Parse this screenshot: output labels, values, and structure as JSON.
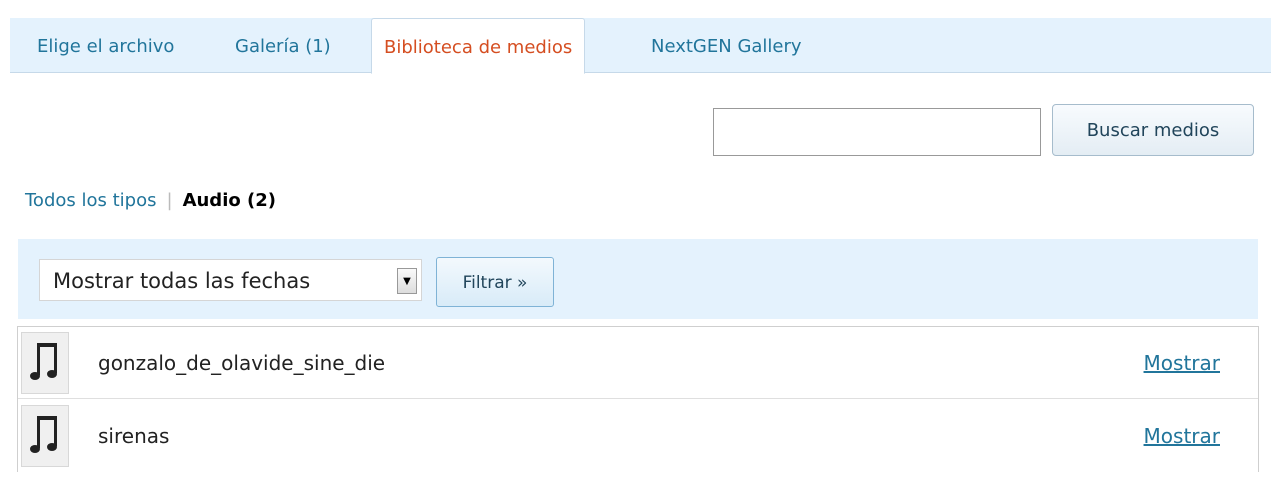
{
  "tabs": [
    {
      "label": "Elige el archivo",
      "active": false
    },
    {
      "label": "Galería (1)",
      "active": false
    },
    {
      "label": "Biblioteca de medios",
      "active": true
    },
    {
      "label": "NextGEN Gallery",
      "active": false
    }
  ],
  "search": {
    "value": "",
    "button_label": "Buscar medios"
  },
  "type_filter": {
    "all_label": "Todos los tipos",
    "separator": "|",
    "current_label": "Audio (2)"
  },
  "filter_bar": {
    "date_selected": "Mostrar todas las fechas",
    "filter_button": "Filtrar »"
  },
  "media_items": [
    {
      "icon": "audio-note-icon",
      "title": "gonzalo_de_olavide_sine_die",
      "action": "Mostrar"
    },
    {
      "icon": "audio-note-icon",
      "title": "sirenas",
      "action": "Mostrar"
    }
  ],
  "colors": {
    "accent_link": "#21759b",
    "active_tab": "#d54e21",
    "bar_bg": "#e4f2fd"
  }
}
